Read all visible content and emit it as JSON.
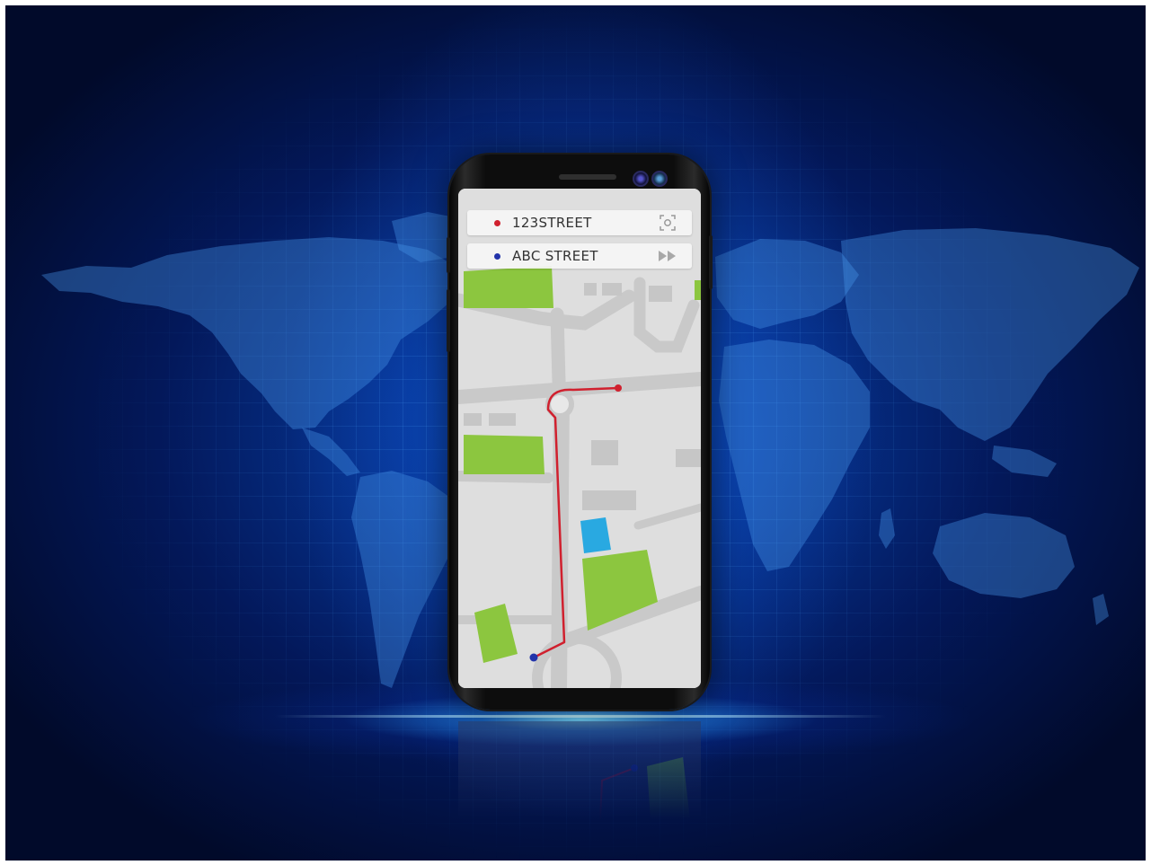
{
  "route": {
    "origin": {
      "label": "123STREET",
      "pin_color": "#d0202e",
      "icon": "locate-target-icon"
    },
    "destination": {
      "label": "ABC STREET",
      "pin_color": "#2233aa",
      "icon": "fast-forward-icon"
    },
    "line_color": "#d0202e"
  },
  "map_colors": {
    "road": "#c9c9c9",
    "block": "#dedede",
    "park": "#8cc63f",
    "water": "#29a9e1"
  }
}
